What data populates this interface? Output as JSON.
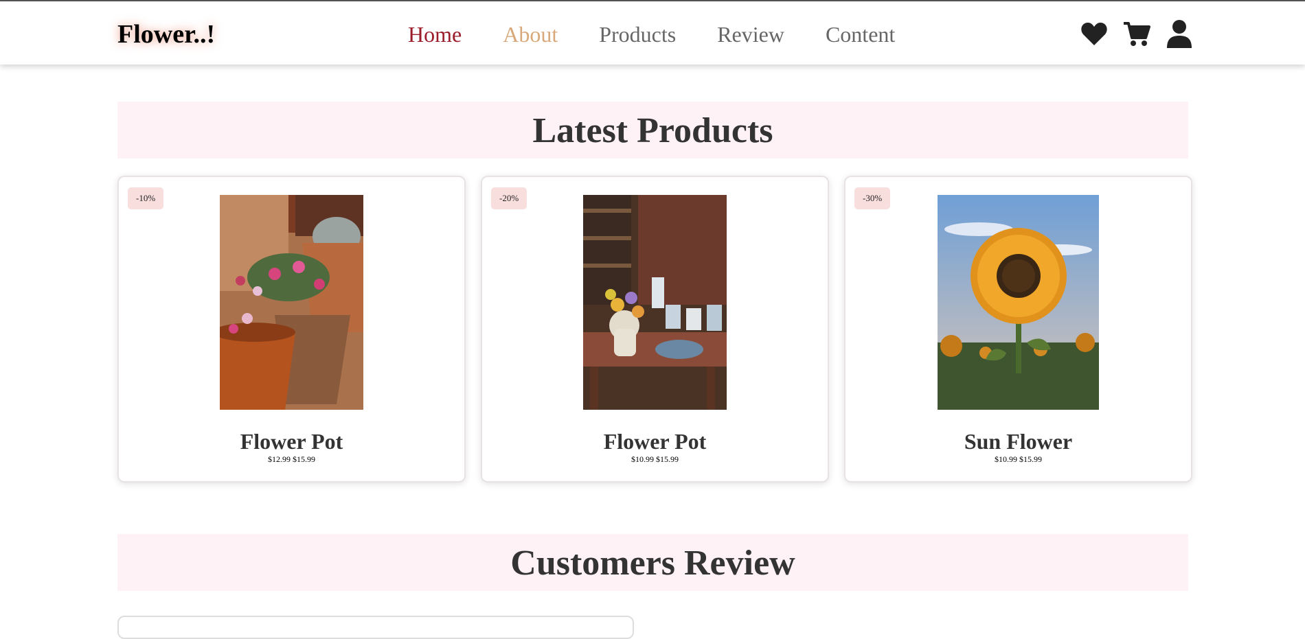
{
  "header": {
    "logo": "Flower..!",
    "nav": [
      {
        "label": "Home",
        "color": "#9b1c2a"
      },
      {
        "label": "About",
        "color": "#d9a87a"
      },
      {
        "label": "Products",
        "color": "#666666"
      },
      {
        "label": "Review",
        "color": "#666666"
      },
      {
        "label": "Content",
        "color": "#666666"
      }
    ],
    "icons": [
      "heart-icon",
      "cart-icon",
      "user-icon"
    ]
  },
  "products": {
    "title": "Latest Products",
    "items": [
      {
        "discount": "-10%",
        "name": "Flower Pot",
        "price": "$12.99 $15.99"
      },
      {
        "discount": "-20%",
        "name": "Flower Pot",
        "price": "$10.99 $15.99"
      },
      {
        "discount": "-30%",
        "name": "Sun Flower",
        "price": "$10.99 $15.99"
      }
    ]
  },
  "reviews": {
    "title": "Customers Review"
  },
  "colors": {
    "section_bg": "#fff2f6",
    "badge_bg": "#f9dede",
    "logo_glow": "#e8785a"
  }
}
